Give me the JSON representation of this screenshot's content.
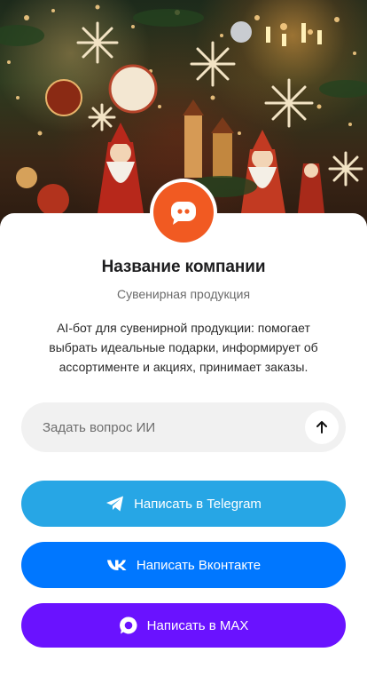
{
  "hero": {
    "alt_icon": "christmas-decorations-image"
  },
  "company": {
    "name": "Название компании",
    "category": "Сувенирная продукция",
    "description": "AI-бот для сувенирной продукции: помогает выбрать идеальные подарки, информирует об ассортименте и акциях, принимает заказы."
  },
  "ask": {
    "placeholder": "Задать вопрос ИИ"
  },
  "buttons": {
    "telegram": "Написать в Telegram",
    "vk": "Написать Вконтакте",
    "max": "Написать в MAX"
  },
  "colors": {
    "brand": "#f15a22",
    "telegram": "#27a6e5",
    "vk": "#0077ff",
    "max": "#6a12ff"
  }
}
